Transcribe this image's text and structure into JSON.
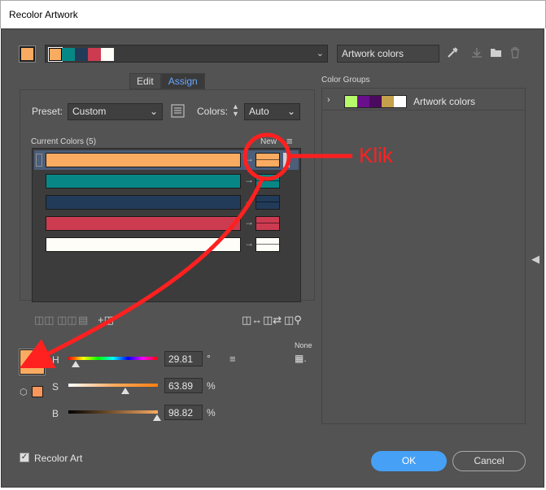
{
  "window": {
    "title": "Recolor Artwork"
  },
  "top": {
    "strip_colors": [
      "#f9ab61",
      "#078887",
      "#223b59",
      "#cd3b51",
      "#fffdf7"
    ],
    "artwork_name": "Artwork colors",
    "icons": [
      "eyedropper-icon",
      "save-icon",
      "folder-icon",
      "trash-icon"
    ]
  },
  "tabs": [
    {
      "label": "Edit"
    },
    {
      "label": "Assign",
      "active": true
    }
  ],
  "preset": {
    "label": "Preset:",
    "value": "Custom"
  },
  "colors": {
    "label": "Colors:",
    "value": "Auto"
  },
  "current_colors": {
    "label": "Current Colors (5)",
    "new_label": "New",
    "rows": [
      {
        "current": "#f9ab61",
        "new": "#f9ab61",
        "selected": true
      },
      {
        "current": "#078887",
        "new": "#078887"
      },
      {
        "current": "#223b59",
        "new": "#223b59"
      },
      {
        "current": "#cd3b51",
        "new": "#cd3b51"
      },
      {
        "current": "#fffdf7",
        "new": "#fffdf7"
      }
    ]
  },
  "color_groups": {
    "label": "Color Groups",
    "items": [
      {
        "name": "Artwork colors",
        "colors": [
          "#b6f96a",
          "#6a0f8b",
          "#4a0b5e",
          "#c5a14b",
          "#ffffff"
        ]
      }
    ]
  },
  "hsb": {
    "h": {
      "label": "H",
      "value": "29.81",
      "unit": "°"
    },
    "s": {
      "label": "S",
      "value": "63.89",
      "unit": "%"
    },
    "b": {
      "label": "B",
      "value": "98.82",
      "unit": "%"
    },
    "swatch": "#f9ab61",
    "none_label": "None"
  },
  "recolor_art": {
    "label": "Recolor Art",
    "checked": true
  },
  "buttons": {
    "ok": "OK",
    "cancel": "Cancel"
  },
  "annotation": {
    "text": "Klik",
    "color": "#ff2020"
  }
}
